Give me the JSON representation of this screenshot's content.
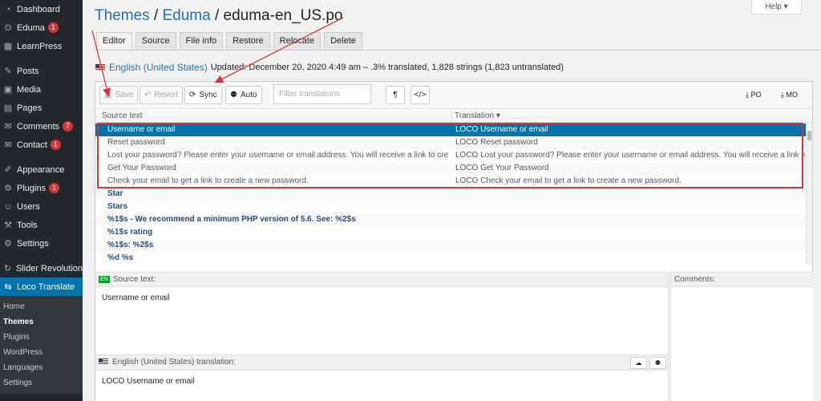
{
  "sidebar": {
    "items": [
      {
        "icon": "dashboard-icon",
        "glyph": "◔",
        "label": "Dashboard"
      },
      {
        "icon": "eduma-icon",
        "glyph": "ʘ",
        "label": "Eduma",
        "badge": "1"
      },
      {
        "icon": "learnpress-icon",
        "glyph": "▦",
        "label": "LearnPress"
      },
      {
        "sep": true
      },
      {
        "icon": "pin-icon",
        "glyph": "✎",
        "label": "Posts"
      },
      {
        "icon": "media-icon",
        "glyph": "▣",
        "label": "Media"
      },
      {
        "icon": "pages-icon",
        "glyph": "▤",
        "label": "Pages"
      },
      {
        "icon": "comments-icon",
        "glyph": "✉",
        "label": "Comments",
        "badge": "7"
      },
      {
        "icon": "contact-icon",
        "glyph": "✉",
        "label": "Contact",
        "badge": "1"
      },
      {
        "sep": true
      },
      {
        "icon": "appearance-icon",
        "glyph": "✐",
        "label": "Appearance"
      },
      {
        "icon": "plugins-icon",
        "glyph": "⚙",
        "label": "Plugins",
        "badge": "1"
      },
      {
        "icon": "users-icon",
        "glyph": "☺",
        "label": "Users"
      },
      {
        "icon": "tools-icon",
        "glyph": "⚒",
        "label": "Tools"
      },
      {
        "icon": "settings-icon",
        "glyph": "⚙",
        "label": "Settings"
      },
      {
        "sep": true
      },
      {
        "icon": "slider-icon",
        "glyph": "↻",
        "label": "Slider Revolution"
      }
    ],
    "active": {
      "icon": "loco-translate-icon",
      "glyph": "⇆",
      "label": "Loco Translate"
    },
    "submenu": [
      {
        "label": "Home",
        "current": false
      },
      {
        "label": "Themes",
        "current": true
      },
      {
        "label": "Plugins",
        "current": false
      },
      {
        "label": "WordPress",
        "current": false
      },
      {
        "label": "Languages",
        "current": false
      },
      {
        "label": "Settings",
        "current": false
      }
    ]
  },
  "header": {
    "crumb_themes": "Themes",
    "sep1": " / ",
    "crumb_theme": "Eduma",
    "sep2": " / ",
    "file": "eduma-en_US.po",
    "help": "Help ▾"
  },
  "tabs": [
    "Editor",
    "Source",
    "File info",
    "Restore",
    "Relocate",
    "Delete"
  ],
  "locale": {
    "name": "English (United States)",
    "info": "Updated: December 20, 2020 4:49 am – .3% translated, 1,828 strings (1,823 untranslated)"
  },
  "toolbar": {
    "save": "Save",
    "revert": "Revert",
    "sync": "Sync",
    "auto": "Auto",
    "filter_placeholder": "Filter translations",
    "pilcrow": "¶",
    "code": "</>",
    "po": "PO",
    "mo": "MO"
  },
  "grid": {
    "col_source": "Source text",
    "col_translation": "Translation ▾",
    "rows": [
      {
        "src": "Username or email",
        "trn": "LOCO Username or email",
        "state": "sel"
      },
      {
        "src": "Reset password",
        "trn": "LOCO Reset password",
        "state": "tr"
      },
      {
        "src": "Lost your password? Please enter your username or email address. You will receive a link to create a ...",
        "trn": "LOCO Lost your password? Please enter your username or email address. You will receive a link to crea...",
        "state": "tr"
      },
      {
        "src": "Get Your Password",
        "trn": "LOCO Get Your Password",
        "state": "tr"
      },
      {
        "src": "Check your email to get a link to create a new password.",
        "trn": "LOCO Check your email to get a link to create a new password.",
        "state": "tr"
      },
      {
        "src": "Star",
        "trn": "",
        "state": "untr"
      },
      {
        "src": "Stars",
        "trn": "",
        "state": "untr"
      },
      {
        "src": "%1$s - We recommend a minimum PHP version of 5.6. See: %2$s",
        "trn": "",
        "state": "untr"
      },
      {
        "src": "%1$s rating",
        "trn": "",
        "state": "untr"
      },
      {
        "src": "%1$s: %2$s",
        "trn": "",
        "state": "untr"
      },
      {
        "src": "%d %s",
        "trn": "",
        "state": "untr"
      }
    ]
  },
  "source_panel": {
    "head": "Source text:",
    "lang": "EN",
    "value": "Username or email"
  },
  "translation_panel": {
    "head": "English (United States) translation:",
    "value": "LOCO Username or email"
  },
  "comments_panel": {
    "head": "Comments:"
  },
  "colors": {
    "accent": "#0073aa",
    "annotation": "#d63638"
  }
}
